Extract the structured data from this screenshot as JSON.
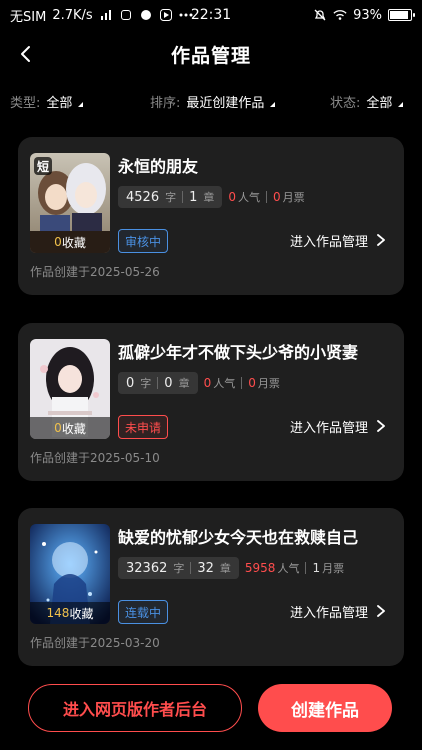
{
  "status_bar": {
    "carrier": "无SIM",
    "speed": "2.7K/s",
    "time": "22:31",
    "battery": "93%",
    "icons": [
      "signal-icon",
      "app-icon-1",
      "app-icon-2",
      "app-icon-3",
      "more-icon",
      "bell-off-icon",
      "wifi-icon",
      "battery-icon"
    ]
  },
  "header": {
    "title": "作品管理",
    "back_icon": "chevron-left-icon"
  },
  "filters": {
    "type": {
      "label": "类型:",
      "value": "全部"
    },
    "sort": {
      "label": "排序:",
      "value": "最近创建作品"
    },
    "state": {
      "label": "状态:",
      "value": "全部"
    }
  },
  "works": [
    {
      "title": "永恒的朋友",
      "favorites": "0",
      "favorites_label": "收藏",
      "cover_tag": "短",
      "words": "4526",
      "words_unit": "字",
      "chapters": "1",
      "chapters_unit": "章",
      "popularity": "0",
      "popularity_unit": "人气",
      "monthly": "0",
      "monthly_unit": "月票",
      "status": "审核中",
      "manage_label": "进入作品管理",
      "created": "作品创建于2025-05-26"
    },
    {
      "title": "孤僻少年才不做下头少爷的小贤妻",
      "favorites": "0",
      "favorites_label": "收藏",
      "cover_tag": "",
      "words": "0",
      "words_unit": "字",
      "chapters": "0",
      "chapters_unit": "章",
      "popularity": "0",
      "popularity_unit": "人气",
      "monthly": "0",
      "monthly_unit": "月票",
      "status": "未申请",
      "manage_label": "进入作品管理",
      "created": "作品创建于2025-05-10"
    },
    {
      "title": "缺爱的忧郁少女今天也在救赎自己",
      "favorites": "148",
      "favorites_label": "收藏",
      "cover_tag": "",
      "words": "32362",
      "words_unit": "字",
      "chapters": "32",
      "chapters_unit": "章",
      "popularity": "5958",
      "popularity_unit": "人气",
      "monthly": "1",
      "monthly_unit": "月票",
      "status": "连载中",
      "manage_label": "进入作品管理",
      "created": "作品创建于2025-03-20"
    }
  ],
  "bottom": {
    "web_backend": "进入网页版作者后台",
    "create": "创建作品"
  },
  "colors": {
    "accent_red": "#ff4d4d",
    "accent_blue": "#4a90e2",
    "gold": "#f0c14b",
    "card_bg": "#1f1f1f"
  }
}
